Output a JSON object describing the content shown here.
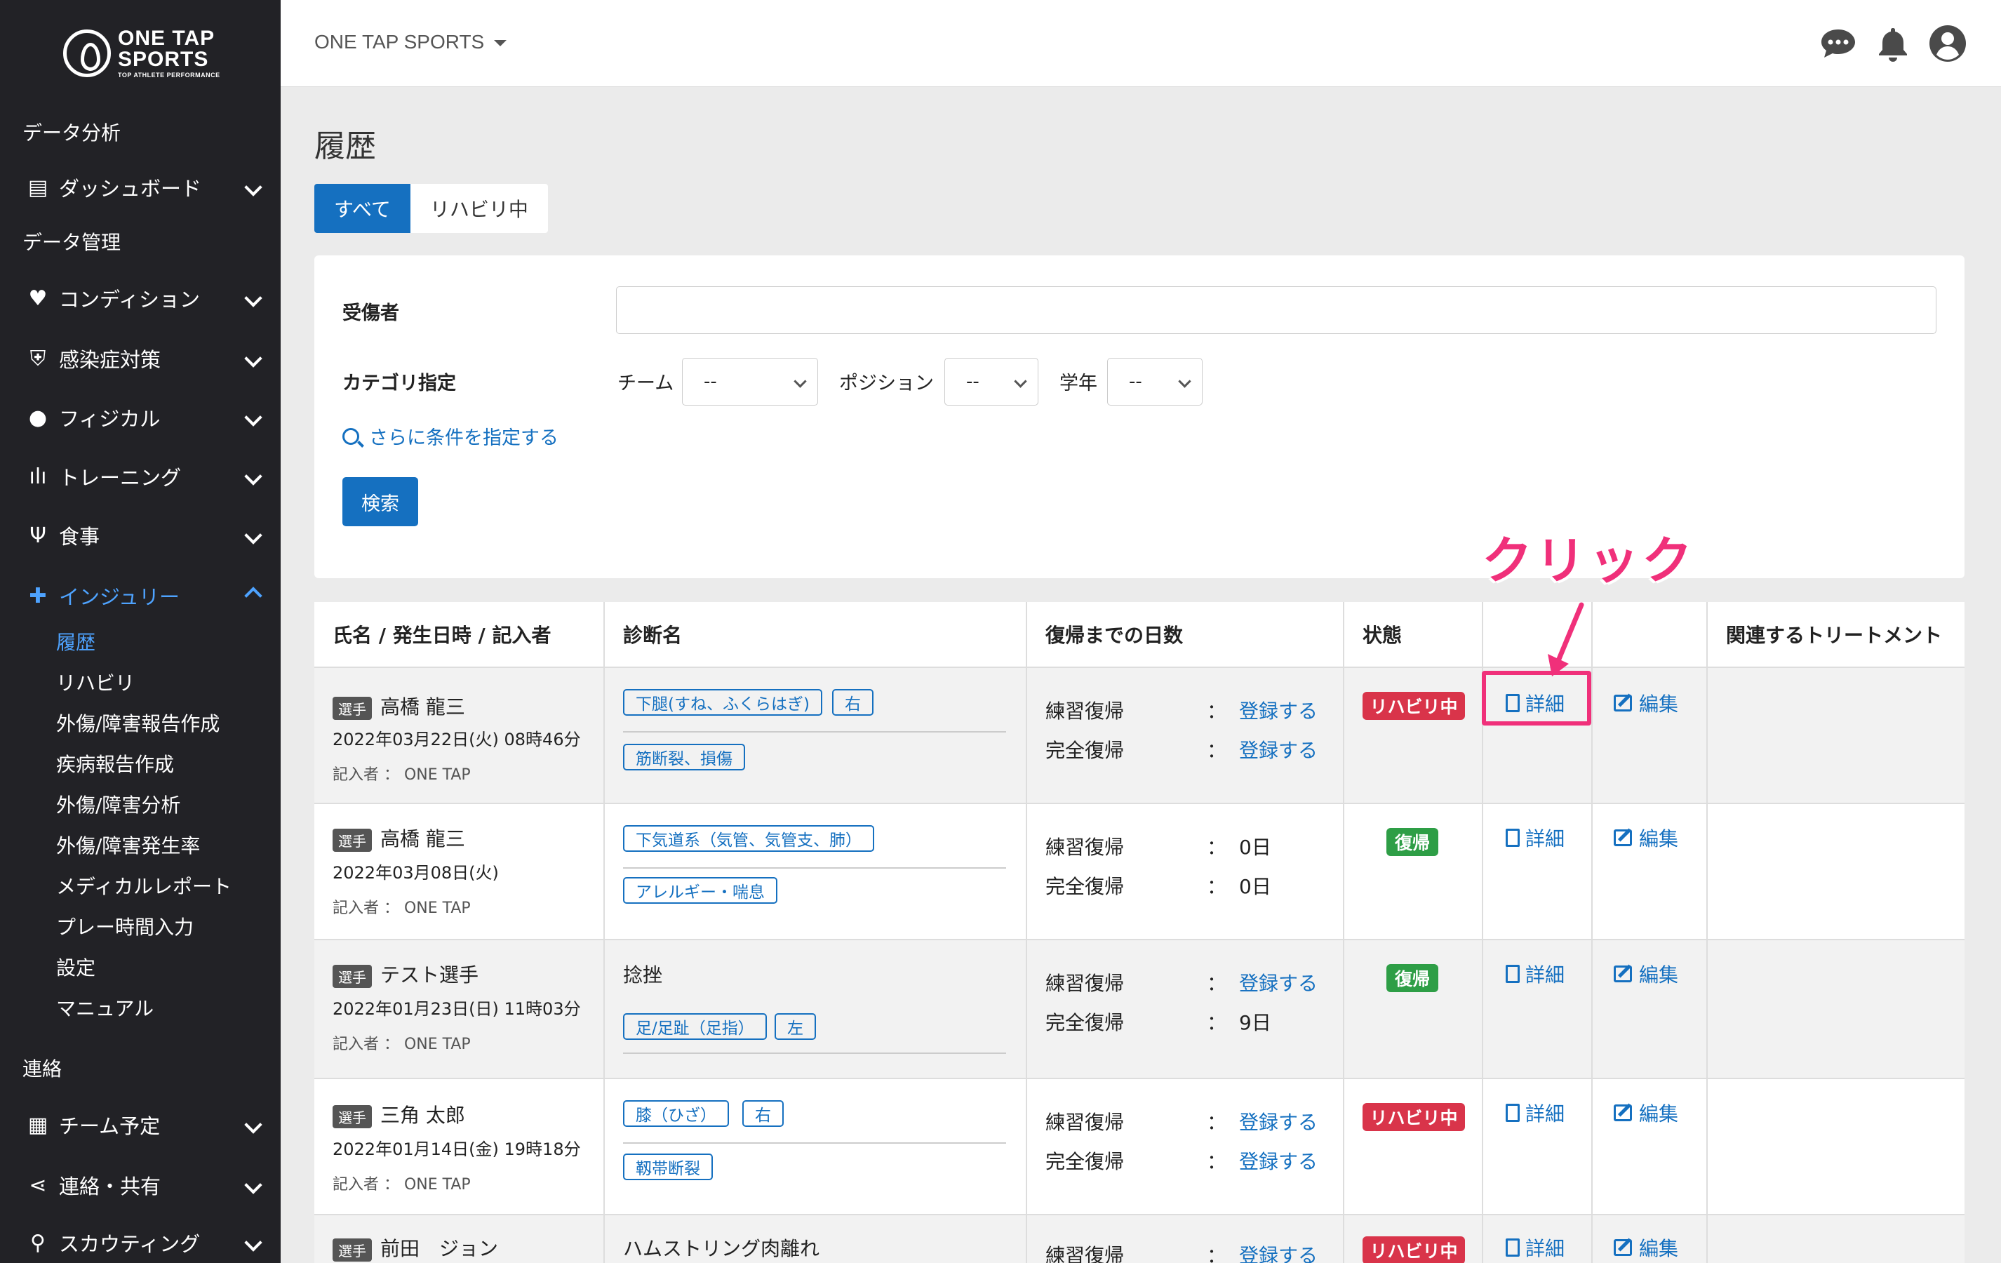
{
  "logo": {
    "line1": "ONE TAP",
    "line2": "SPORTS",
    "tagline": "TOP ATHLETE PERFORMANCE"
  },
  "sidebar": {
    "analysis_header": "データ分析",
    "dashboard": "ダッシュボード",
    "data_mgmt_header": "データ管理",
    "condition": "コンディション",
    "infection": "感染症対策",
    "physical": "フィジカル",
    "training": "トレーニング",
    "meal": "食事",
    "injury": "インジュリー",
    "injury_sub": [
      "履歴",
      "リハビリ",
      "外傷/障害報告作成",
      "疾病報告作成",
      "外傷/障害分析",
      "外傷/障害発生率",
      "メディカルレポート",
      "プレー時間入力",
      "設定",
      "マニュアル"
    ],
    "contact_header": "連絡",
    "team_schedule": "チーム予定",
    "contact_share": "連絡・共有",
    "scouting": "スカウティング"
  },
  "topbar": {
    "brand": "ONE TAP SPORTS"
  },
  "page": {
    "title": "履歴"
  },
  "tabs": {
    "all": "すべて",
    "rehab": "リハビリ中"
  },
  "filter": {
    "injured_label": "受傷者",
    "injured_value": "",
    "category_label": "カテゴリ指定",
    "team_label": "チーム",
    "team_value": "--",
    "position_label": "ポジション",
    "position_value": "--",
    "grade_label": "学年",
    "grade_value": "--",
    "more_conditions": "さらに条件を指定する",
    "search_button": "検索"
  },
  "annotation": {
    "text": "クリック",
    "color": "#f0307a"
  },
  "table": {
    "headers": [
      "氏名 / 発生日時 / 記入者",
      "診断名",
      "復帰までの日数",
      "状態",
      "",
      "",
      "関連するトリートメント"
    ],
    "practice_label": "練習復帰",
    "full_label": "完全復帰",
    "colon": "：",
    "detail_label": "詳細",
    "edit_label": "編集",
    "player_badge": "選手",
    "rows": [
      {
        "name": "高橋 龍三",
        "date": "2022年03月22日(火) 08時46分",
        "recorder": "記入者 ： ONE TAP",
        "tags1": [
          "下腿(すね、ふくらはぎ)",
          "右"
        ],
        "tags2": [
          "筋断裂、損傷"
        ],
        "practice": "登録する",
        "full": "登録する",
        "status": "リハビリ中"
      },
      {
        "name": "高橋 龍三",
        "date": "2022年03月08日(火)",
        "recorder": "記入者 ： ONE TAP",
        "tags1": [
          "下気道系（気管、気管支、肺）"
        ],
        "tags2": [
          "アレルギー・喘息"
        ],
        "practice": "0日",
        "full": "0日",
        "status": "復帰"
      },
      {
        "name": "テスト選手",
        "date": "2022年01月23日(日) 11時03分",
        "recorder": "記入者 ： ONE TAP",
        "diag_text": "捻挫",
        "tags2": [
          "足/足趾（足指）",
          "左"
        ],
        "practice": "登録する",
        "full": "9日",
        "status": "復帰"
      },
      {
        "name": "三角 太郎",
        "date": "2022年01月14日(金) 19時18分",
        "recorder": "記入者 ： ONE TAP",
        "tags1": [
          "膝（ひざ）",
          "右"
        ],
        "tags2": [
          "靱帯断裂"
        ],
        "practice": "登録する",
        "full": "登録する",
        "status": "リハビリ中"
      },
      {
        "name": "前田　ジョン",
        "diag_text": "ハムストリング肉離れ",
        "practice": "登録する",
        "status": "リハビリ中"
      }
    ]
  }
}
